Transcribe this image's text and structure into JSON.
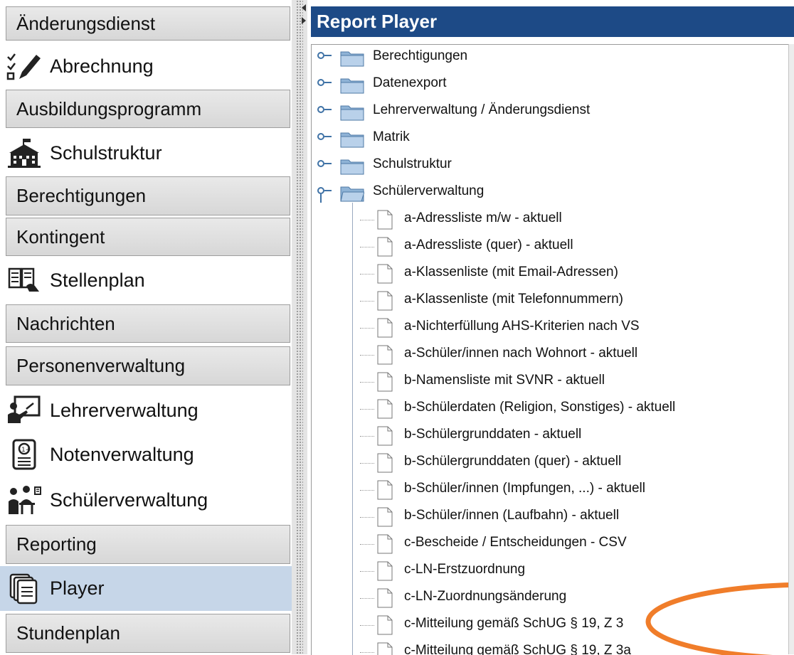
{
  "nav": {
    "items": [
      {
        "label": "Änderungsdienst",
        "type": "category"
      },
      {
        "label": "Abrechnung",
        "type": "module",
        "icon": "checklist-pen-icon"
      },
      {
        "label": "Ausbildungsprogramm",
        "type": "category"
      },
      {
        "label": "Schulstruktur",
        "type": "module",
        "icon": "school-building-icon"
      },
      {
        "label": "Berechtigungen",
        "type": "category"
      },
      {
        "label": "Kontingent",
        "type": "category"
      },
      {
        "label": "Stellenplan",
        "type": "module",
        "icon": "book-hand-icon"
      },
      {
        "label": "Nachrichten",
        "type": "category"
      },
      {
        "label": "Personenverwaltung",
        "type": "category"
      },
      {
        "label": "Lehrerverwaltung",
        "type": "module",
        "icon": "teacher-board-icon"
      },
      {
        "label": "Notenverwaltung",
        "type": "module",
        "icon": "grade-certificate-icon"
      },
      {
        "label": "Schülerverwaltung",
        "type": "module",
        "icon": "students-desk-icon"
      },
      {
        "label": "Reporting",
        "type": "category"
      },
      {
        "label": "Player",
        "type": "module",
        "icon": "documents-stack-icon",
        "selected": true
      },
      {
        "label": "Stundenplan",
        "type": "category"
      }
    ]
  },
  "player": {
    "title": "Report Player",
    "folders": [
      "Berechtigungen",
      "Datenexport",
      "Lehrerverwaltung / Änderungsdienst",
      "Matrik",
      "Schulstruktur",
      "Schülerverwaltung"
    ],
    "reports": [
      "a-Adressliste m/w - aktuell",
      "a-Adressliste (quer) - aktuell",
      "a-Klassenliste (mit Email-Adressen)",
      "a-Klassenliste (mit Telefonnummern)",
      "a-Nichterfüllung AHS-Kriterien nach VS",
      "a-Schüler/innen nach Wohnort - aktuell",
      "b-Namensliste mit SVNR - aktuell",
      "b-Schülerdaten (Religion, Sonstiges) - aktuell",
      "b-Schülergrunddaten - aktuell",
      "b-Schülergrunddaten (quer) - aktuell",
      "b-Schüler/innen (Impfungen, ...) - aktuell",
      "b-Schüler/innen (Laufbahn) - aktuell",
      "c-Bescheide / Entscheidungen - CSV",
      "c-LN-Erstzuordnung",
      "c-LN-Zuordnungsänderung",
      "c-Mitteilung gemäß SchUG § 19, Z 3",
      "c-Mitteilung gemäß SchUG § 19, Z 3a"
    ]
  },
  "colors": {
    "title_bg": "#1d4a86",
    "highlight": "#f07d2a",
    "selected_bg": "#c6d6e8"
  }
}
